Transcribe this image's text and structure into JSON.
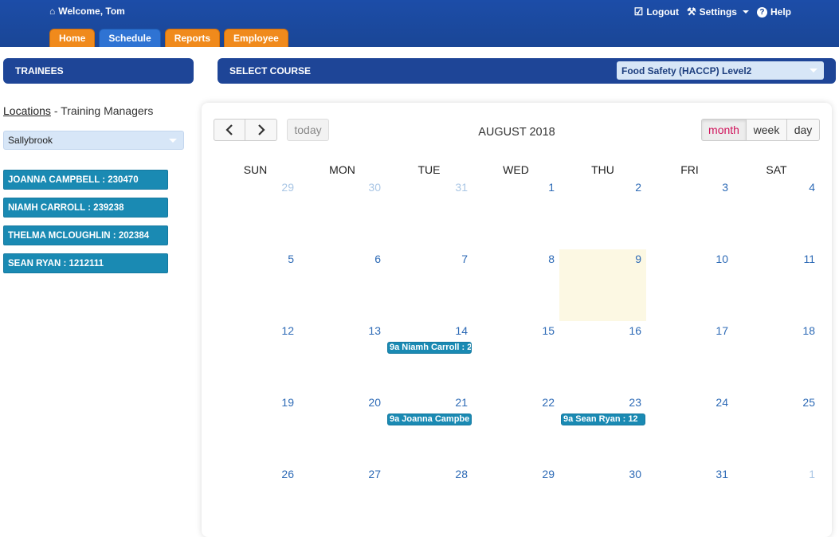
{
  "header": {
    "welcome": "Welcome, Tom",
    "logout": "Logout",
    "settings": "Settings",
    "help": "Help",
    "tabs": [
      {
        "label": "Home",
        "active": false
      },
      {
        "label": "Schedule",
        "active": true
      },
      {
        "label": "Reports",
        "active": false
      },
      {
        "label": "Employee",
        "active": false
      }
    ]
  },
  "left": {
    "title": "TRAINEES",
    "locations_link": "Locations",
    "locations_suffix": " - Training Managers",
    "location_selected": "Sallybrook",
    "trainees": [
      "JOANNA CAMPBELL : 230470",
      "NIAMH CARROLL : 239238",
      "THELMA MCLOUGHLIN : 202384",
      "SEAN RYAN : 1212111"
    ]
  },
  "course": {
    "title": "SELECT COURSE",
    "selected": "Food Safety (HACCP) Level2"
  },
  "calendar": {
    "title": "AUGUST 2018",
    "today_label": "today",
    "views": {
      "month": "month",
      "week": "week",
      "day": "day"
    },
    "active_view": "month",
    "dow": [
      "SUN",
      "MON",
      "TUE",
      "WED",
      "THU",
      "FRI",
      "SAT"
    ],
    "weeks": [
      [
        {
          "d": "29",
          "o": true
        },
        {
          "d": "30",
          "o": true
        },
        {
          "d": "31",
          "o": true
        },
        {
          "d": "1"
        },
        {
          "d": "2"
        },
        {
          "d": "3"
        },
        {
          "d": "4"
        }
      ],
      [
        {
          "d": "5"
        },
        {
          "d": "6"
        },
        {
          "d": "7"
        },
        {
          "d": "8"
        },
        {
          "d": "9",
          "today": true
        },
        {
          "d": "10"
        },
        {
          "d": "11"
        }
      ],
      [
        {
          "d": "12"
        },
        {
          "d": "13"
        },
        {
          "d": "14",
          "event": "9a Niamh Carroll : 2"
        },
        {
          "d": "15"
        },
        {
          "d": "16"
        },
        {
          "d": "17"
        },
        {
          "d": "18"
        }
      ],
      [
        {
          "d": "19"
        },
        {
          "d": "20"
        },
        {
          "d": "21",
          "event": "9a Joanna Campbe"
        },
        {
          "d": "22"
        },
        {
          "d": "23",
          "event": "9a Sean Ryan : 12"
        },
        {
          "d": "24"
        },
        {
          "d": "25"
        }
      ],
      [
        {
          "d": "26"
        },
        {
          "d": "27"
        },
        {
          "d": "28"
        },
        {
          "d": "29"
        },
        {
          "d": "30"
        },
        {
          "d": "31"
        },
        {
          "d": "1",
          "o": true
        }
      ]
    ]
  },
  "colors": {
    "header": "#1a4696",
    "tab_orange": "#f08a1c",
    "tab_active": "#2f73d3",
    "event": "#1a8ab3",
    "today_bg": "#fcf8e3"
  }
}
